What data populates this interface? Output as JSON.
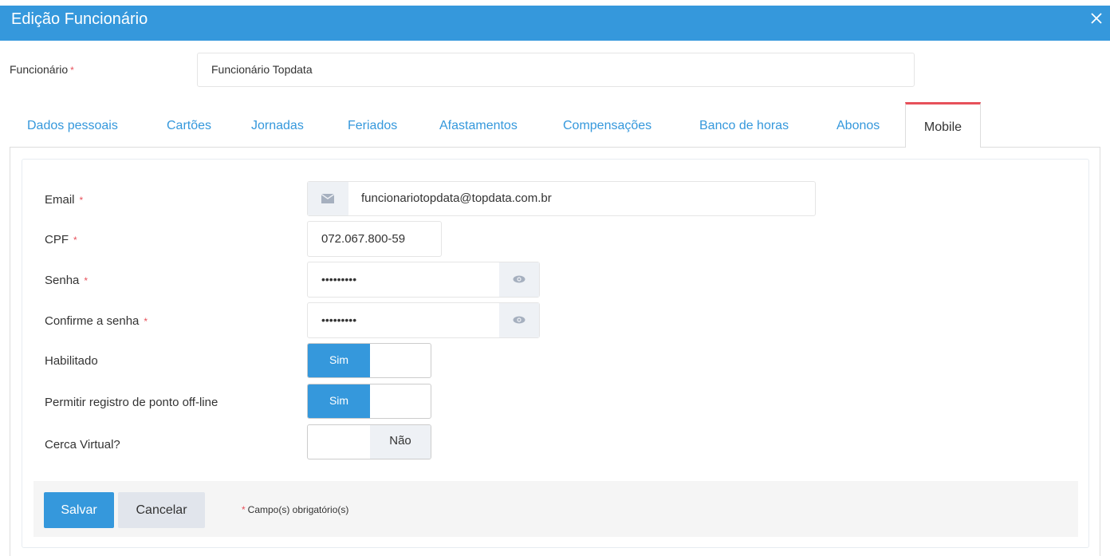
{
  "window": {
    "title": "Edição Funcionário",
    "header_color": "#3598dc"
  },
  "employee": {
    "label": "Funcionário",
    "required_mark": "*",
    "value": "Funcionário Topdata"
  },
  "tabs": [
    {
      "label": "Dados pessoais",
      "active": false
    },
    {
      "label": "Cartões",
      "active": false
    },
    {
      "label": "Jornadas",
      "active": false
    },
    {
      "label": "Feriados",
      "active": false
    },
    {
      "label": "Afastamentos",
      "active": false
    },
    {
      "label": "Compensações",
      "active": false
    },
    {
      "label": "Banco de horas",
      "active": false
    },
    {
      "label": "Abonos",
      "active": false
    },
    {
      "label": "Mobile",
      "active": true
    }
  ],
  "form": {
    "email": {
      "label": "Email",
      "required_mark": "*",
      "value": "funcionariotopdata@topdata.com.br",
      "icon": "envelope-icon"
    },
    "cpf": {
      "label": "CPF",
      "required_mark": "*",
      "value": "072.067.800-59"
    },
    "password": {
      "label": "Senha",
      "required_mark": "*",
      "value": "•••••••••",
      "icon": "eye-icon"
    },
    "confirm_password": {
      "label": "Confirme a senha",
      "required_mark": "*",
      "value": "•••••••••",
      "icon": "eye-icon"
    },
    "enabled": {
      "label": "Habilitado",
      "state_label": "Sim",
      "on": true
    },
    "offline": {
      "label": "Permitir registro de ponto off-line",
      "state_label": "Sim",
      "on": true
    },
    "geofence": {
      "label": "Cerca Virtual?",
      "state_label": "Não",
      "on": false
    }
  },
  "footer": {
    "save_label": "Salvar",
    "cancel_label": "Cancelar",
    "required_mark": "*",
    "required_note": "Campo(s) obrigatório(s)"
  },
  "colors": {
    "accent": "#3598dc",
    "required": "#e7505a",
    "active_tab_border": "#e7505a"
  }
}
